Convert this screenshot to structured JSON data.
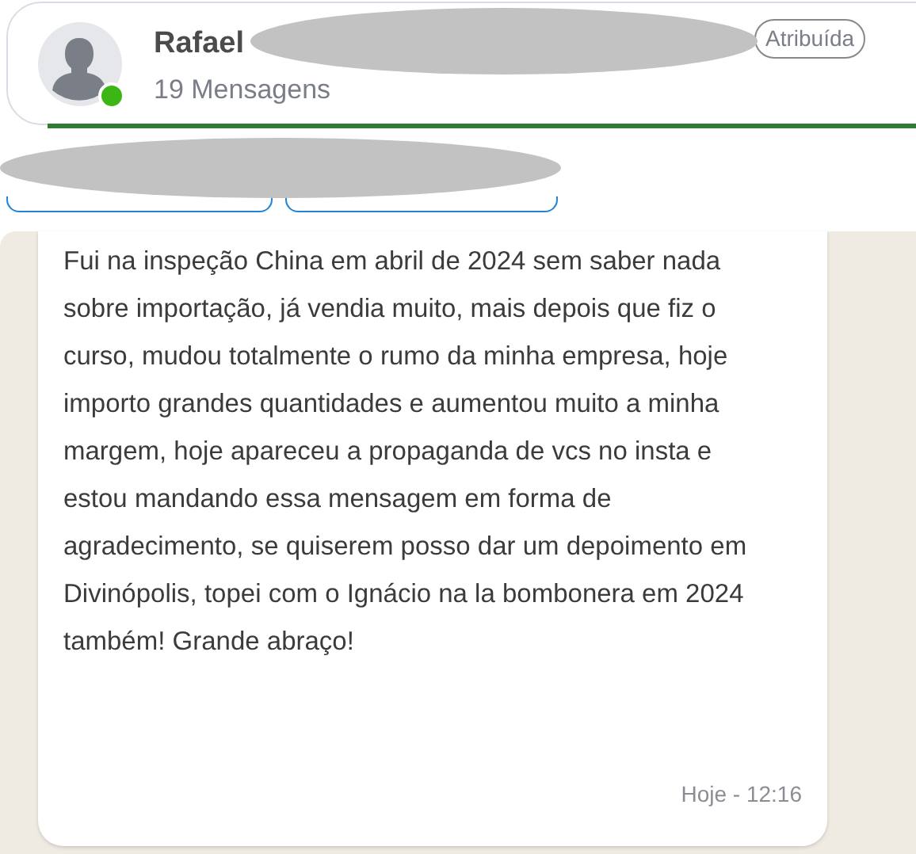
{
  "contact": {
    "name": "Rafael",
    "online": true,
    "message_count": "19 Mensagens",
    "badge": "Atribuída"
  },
  "message": {
    "text": "Fui na inspeção China em abril de 2024 sem saber nada sobre importação, já vendia muito, mais depois que fiz o curso, mudou totalmente o rumo da minha empresa, hoje importo grandes quantidades e aumentou muito a minha margem, hoje apareceu a propaganda de vcs no insta e estou mandando essa mensagem em forma de agradecimento, se quiserem posso dar um depoimento em Divinópolis, topei com o Ignácio na la bombonera em 2024 também! Grande abraço!",
    "time": "Hoje - 12:16"
  }
}
